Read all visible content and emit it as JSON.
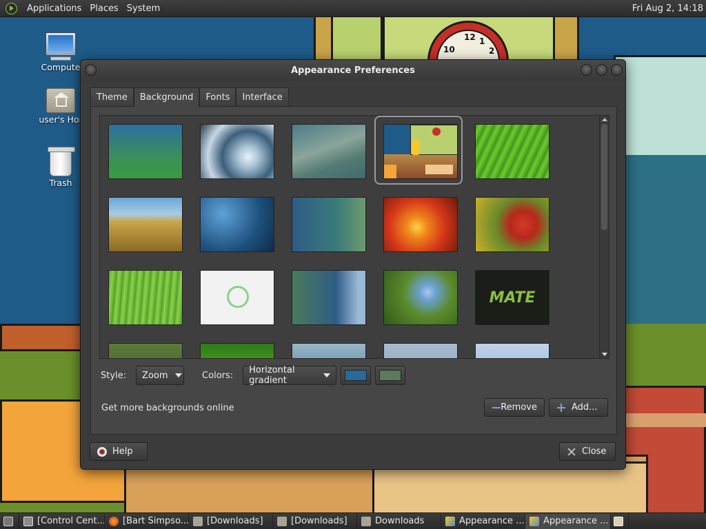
{
  "top_panel": {
    "menus": [
      "Applications",
      "Places",
      "System"
    ],
    "clock": "Fri Aug  2, 14:18"
  },
  "desktop": {
    "icons": [
      {
        "label": "Compute",
        "icon": "computer-icon"
      },
      {
        "label": "user's Hor",
        "icon": "home-folder-icon"
      },
      {
        "label": "Trash",
        "icon": "trash-icon"
      }
    ]
  },
  "wallpaper": {
    "clock_numbers": [
      "12",
      "1",
      "10",
      "2"
    ]
  },
  "dialog": {
    "title": "Appearance Preferences",
    "tabs": [
      "Theme",
      "Background",
      "Fonts",
      "Interface"
    ],
    "active_tab": "Background",
    "thumbnails": [
      "green-blue-gradient",
      "water-drop",
      "blue-green-haze",
      "bart-simpson-classroom",
      "green-leaf",
      "beach-grass",
      "blue-droplets",
      "teal-bokeh",
      "orange-flower",
      "red-flower",
      "green-grass",
      "mate-logo-white",
      "blue-waves",
      "blue-flowers",
      "mate-logo-dark",
      "partial-1",
      "partial-2",
      "partial-3",
      "partial-4",
      "partial-5"
    ],
    "selected_index": 3,
    "mate_text": "MATE",
    "style_label": "Style:",
    "style_value": "Zoom",
    "colors_label": "Colors:",
    "colors_value": "Horizontal gradient",
    "color_primary": "#2a6a9a",
    "color_secondary": "#5e7a5a",
    "online_text": "Get more backgrounds online",
    "remove_label": "Remove",
    "add_label": "Add...",
    "help_label": "Help",
    "close_label": "Close"
  },
  "taskbar": {
    "items": [
      {
        "label": "[Control Cent...",
        "icon": "control-center-icon"
      },
      {
        "label": "[Bart Simpso...",
        "icon": "firefox-icon"
      },
      {
        "label": "[Downloads]",
        "icon": "folder-icon"
      },
      {
        "label": "[Downloads]",
        "icon": "folder-icon"
      },
      {
        "label": "Downloads",
        "icon": "folder-icon"
      },
      {
        "label": "Appearance ...",
        "icon": "appearance-icon"
      },
      {
        "label": "Appearance ...",
        "icon": "appearance-icon"
      }
    ],
    "active_index": 6
  }
}
